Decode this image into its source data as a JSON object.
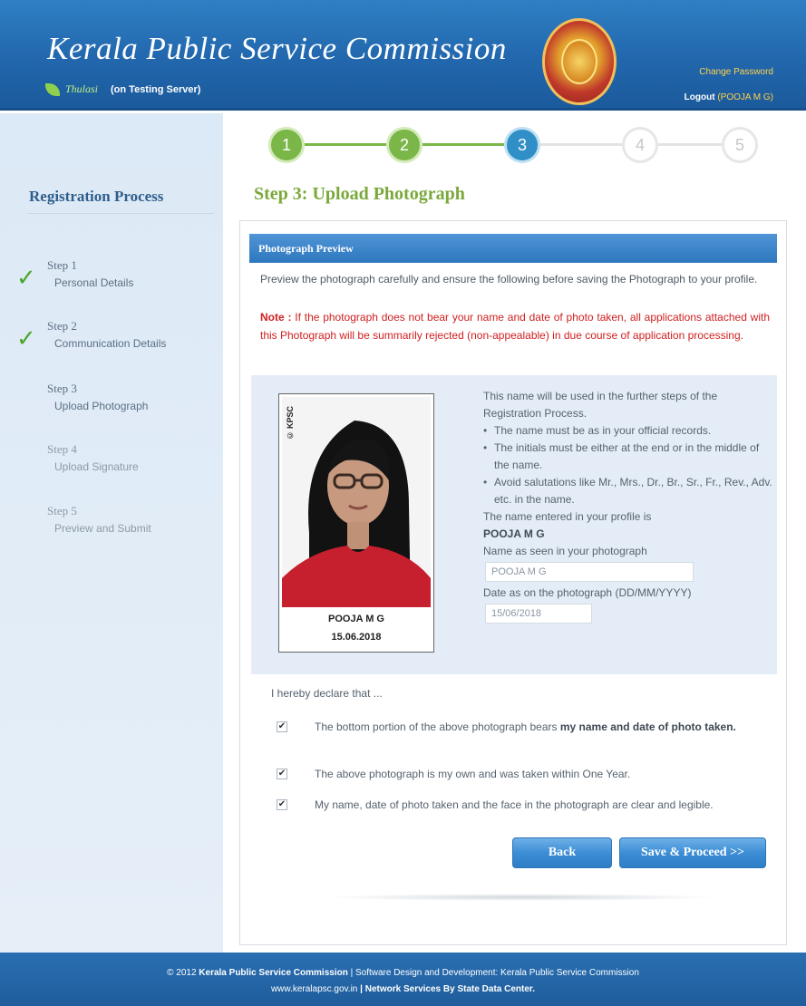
{
  "header": {
    "title": "Kerala Public Service Commission",
    "thulasi": "Thulasi",
    "server_note": "(on Testing Server)",
    "change_password": "Change Password",
    "logout": "Logout",
    "user": "(POOJA M G)"
  },
  "sidebar": {
    "title": "Registration Process",
    "steps": [
      {
        "name": "Step 1",
        "desc": "Personal Details",
        "done": true
      },
      {
        "name": "Step 2",
        "desc": "Communication Details",
        "done": true
      },
      {
        "name": "Step 3",
        "desc": "Upload Photograph",
        "done": false
      },
      {
        "name": "Step 4",
        "desc": "Upload Signature",
        "done": false
      },
      {
        "name": "Step 5",
        "desc": "Preview and Submit",
        "done": false
      }
    ]
  },
  "progress": {
    "steps": [
      "1",
      "2",
      "3",
      "4",
      "5"
    ],
    "current": 3
  },
  "main": {
    "heading": "Step 3: Upload Photograph",
    "panel_title": "Photograph Preview",
    "instructions": "Preview the photograph carefully and ensure the following before saving the Photograph to your profile.",
    "note_label": "Note :",
    "note_text": "If the photograph does not bear your name and date of photo taken, all applications attached with this Photograph will be summarily rejected (non-appealable) in due course of application processing."
  },
  "photo": {
    "watermark": "© KPSC",
    "caption_name": "POOJA M G",
    "caption_date": "15.06.2018"
  },
  "info": {
    "intro": "This name will be used in the further steps of the Registration Process.",
    "bullets": [
      "The name must be as in your official records.",
      "The initials must be either at the end or in the middle of the name.",
      "Avoid salutations like Mr., Mrs., Dr., Br., Sr., Fr., Rev., Adv. etc. in the name."
    ],
    "profile_label": "The name entered in your profile is",
    "profile_name": "POOJA M G",
    "name_label": "Name as seen in your photograph",
    "name_value": "POOJA M G",
    "date_label": "Date as on the photograph (DD/MM/YYYY)",
    "date_value": "15/06/2018"
  },
  "declaration": {
    "title": "I hereby declare that ...",
    "items": [
      {
        "text": "The bottom portion of the above photograph bears ",
        "bold": "my name and date of photo taken.",
        "checked": true
      },
      {
        "text": "The above photograph is my own and was taken within One Year.",
        "bold": "",
        "checked": true
      },
      {
        "text": "My name, date of photo taken and the face in the photograph are clear and legible.",
        "bold": "",
        "checked": true
      }
    ]
  },
  "buttons": {
    "back": "Back",
    "save": "Save & Proceed >>"
  },
  "footer": {
    "line1_prefix": "© 2012",
    "line1_org": "Kerala Public Service Commission",
    "line1_rest": "| Software Design and Development: Kerala Public Service Commission",
    "line2_url": "www.keralapsc.gov.in",
    "line2_rest": "| Network Services By State Data Center."
  },
  "colors": {
    "header_blue": "#2267ad",
    "step_done_green": "#7ab648",
    "step_active_blue": "#2f8fc6",
    "note_red": "#d02020",
    "heading_green": "#7aa83a"
  }
}
